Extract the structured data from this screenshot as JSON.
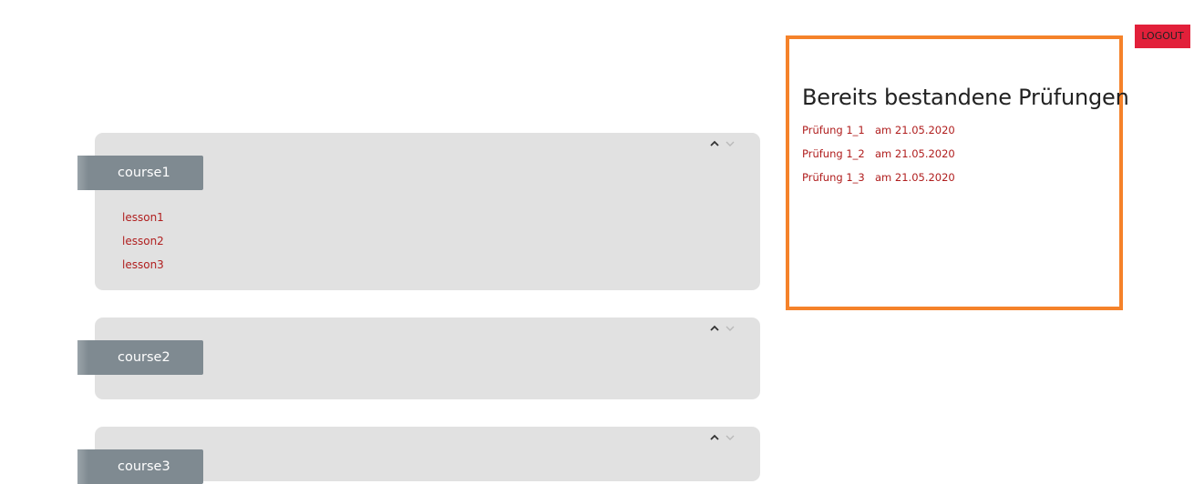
{
  "header": {
    "logout_label": "LOGOUT"
  },
  "courses": [
    {
      "name": "course1",
      "lessons": [
        "lesson1",
        "lesson2",
        "lesson3"
      ]
    },
    {
      "name": "course2",
      "lessons": []
    },
    {
      "name": "course3",
      "lessons": []
    }
  ],
  "exams": {
    "title": "Bereits bestandene Prüfungen",
    "items": [
      {
        "name": "Prüfung 1_1",
        "date": "am 21.05.2020"
      },
      {
        "name": "Prüfung 1_2",
        "date": "am 21.05.2020"
      },
      {
        "name": "Prüfung 1_3",
        "date": "am 21.05.2020"
      }
    ]
  },
  "icons": {
    "expand_up": "chevron-up-icon",
    "collapse_down": "chevron-down-icon"
  },
  "colors": {
    "logout_bg": "#e2203a",
    "panel_border": "#f5822a",
    "card_bg": "#e1e1e1",
    "tab_bg": "#7f8a91",
    "link_red": "#b01e1e"
  }
}
